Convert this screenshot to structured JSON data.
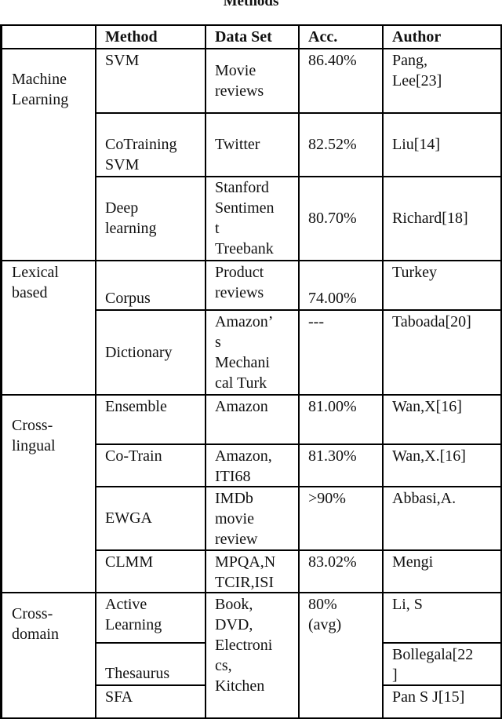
{
  "title": "Methods",
  "header": {
    "category": "",
    "method": "Method",
    "dataset": "Data Set",
    "acc": "Acc.",
    "author": "Author"
  },
  "groups": [
    {
      "category": "Machine\nLearning",
      "rows": [
        {
          "method": "SVM",
          "dataset": "Movie\nreviews",
          "acc": "86.40%",
          "author": "Pang,\nLee[23]"
        },
        {
          "method": "CoTraining\nSVM",
          "dataset": "Twitter",
          "acc": "82.52%",
          "author": "Liu[14]"
        },
        {
          "method": "Deep\nlearning",
          "dataset": "Stanford\nSentimen\nt\nTreebank",
          "acc": "80.70%",
          "author": "Richard[18]"
        }
      ]
    },
    {
      "category": "Lexical\nbased",
      "rows": [
        {
          "method": "Corpus",
          "dataset": "Product\nreviews",
          "acc": "74.00%",
          "author": "Turkey"
        },
        {
          "method": "Dictionary",
          "dataset": "Amazon’\ns\nMechani\ncal Turk",
          "acc": "---",
          "author": "Taboada[20]"
        }
      ]
    },
    {
      "category": "Cross-\nlingual",
      "rows": [
        {
          "method": "Ensemble",
          "dataset": "Amazon",
          "acc": "81.00%",
          "author": "Wan,X[16]"
        },
        {
          "method": "Co-Train",
          "dataset": "Amazon,\nITI68",
          "acc": "81.30%",
          "author": "Wan,X.[16]"
        },
        {
          "method": "EWGA",
          "dataset": "IMDb\nmovie\nreview",
          "acc": ">90%",
          "author": "Abbasi,A."
        },
        {
          "method": "CLMM",
          "dataset": "MPQA,N\nTCIR,ISI",
          "acc": "83.02%",
          "author": "Mengi"
        }
      ]
    },
    {
      "category": "Cross-\ndomain",
      "shared_dataset": "Book,\nDVD,\nElectroni\ncs,\nKitchen",
      "shared_acc": "80%\n(avg)",
      "rows": [
        {
          "method": "Active\nLearning",
          "author": "Li, S"
        },
        {
          "method": "Thesaurus",
          "author": "Bollegala[22\n]"
        },
        {
          "method": "SFA",
          "author": "Pan S J[15]"
        }
      ]
    }
  ]
}
